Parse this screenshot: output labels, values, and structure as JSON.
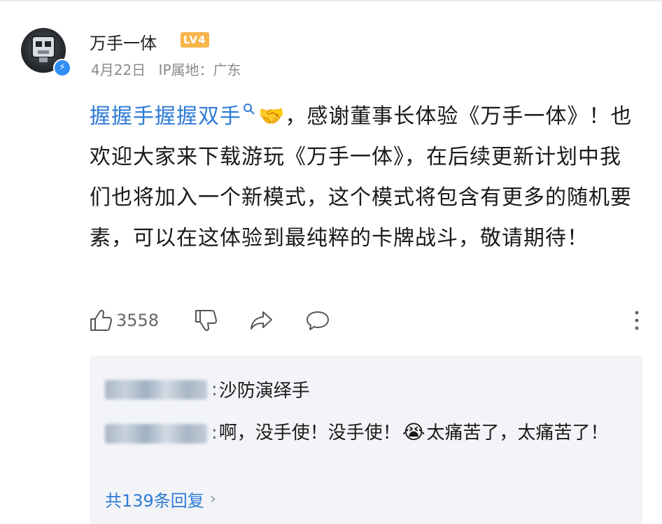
{
  "post": {
    "author": {
      "name": "万手一体",
      "level_badge": "LV4"
    },
    "meta": {
      "date": "4月22日",
      "ip_location": "IP属地：广东"
    },
    "content": {
      "topic_link": "握握手握握双手",
      "emoji_handshake": "🤝",
      "text": "，感谢董事长体验《万手一体》！也欢迎大家来下载游玩《万手一体》，在后续更新计划中我们也将加入一个新模式，这个模式将包含有更多的随机要素，可以在这体验到最纯粹的卡牌战斗，敬请期待！"
    },
    "actions": {
      "like_count": "3558"
    }
  },
  "replies": {
    "first": {
      "text": "沙防演绎手"
    },
    "second": {
      "text_part1": "啊，没手使！没手使！",
      "emoji": "😭",
      "text_part2": "太痛苦了，太痛苦了！"
    },
    "more_label": "共139条回复"
  },
  "colors": {
    "link_blue": "#2e7bd6",
    "level_badge": "#f7b54a",
    "verified_blue": "#2f8ff5",
    "reply_bg": "#f2f4f7"
  }
}
